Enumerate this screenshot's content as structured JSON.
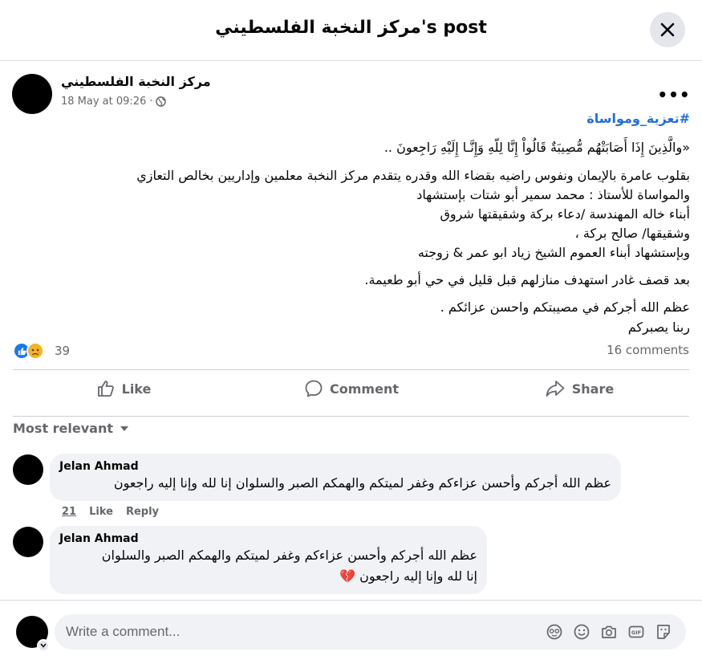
{
  "header": {
    "title": "مركز النخبة الفلسطيني's post"
  },
  "post": {
    "author": "مركز النخبة الفلسطيني",
    "timestamp": "18 May at 09:26",
    "separator": "·",
    "more": "•••",
    "hashtag": "#تعزية_ومواساة",
    "lines": [
      "«والَّذِينَ إِذَا أَصَابَتْهُم مُّصِيبَةٌ قَالُواْ إِنَّا لِلّهِ وَإِنَّـا إِلَيْهِ رَاجِعونَ ..",
      "بقلوب عامرة بالإيمان ونفوس راضيه بقضاء الله وقدره  يتقدم مركز النخبة معلمين وإداريين بخالص التعازي",
      "والمواساة للأستاذ : محمد سمير أبو شتات بإستشهاد",
      "أبناء خاله المهندسة /دعاء بركة وشقيقتها شروق",
      "وشقيقها/ صالح بركة ،",
      "وبإستشهاد أبناء العموم الشيخ زياد ابو عمر & زوجته",
      "بعد قصف غادر استهدف منازلهم قبل قليل في حي أبو طعيمة.",
      "عظم الله أجركم في مصيبتكم واحسن عزائكم .",
      "ربنا يصبركم"
    ],
    "reaction_count": "39",
    "comments_count": "16 comments"
  },
  "actions": {
    "like": "Like",
    "comment": "Comment",
    "share": "Share"
  },
  "sort_label": "Most relevant",
  "comments": [
    {
      "name": "Jelan Ahmad",
      "lines": [
        "عظم الله أجركم وأحسن عزاءكم وغفر لميتكم والهمكم الصبر والسلوان إنا لله وإنا إليه راجعون"
      ],
      "time": "21",
      "like": "Like",
      "reply": "Reply"
    },
    {
      "name": "Jelan Ahmad",
      "lines": [
        "عظم الله أجركم وأحسن عزاءكم وغفر لميتكم والهمكم الصبر والسلوان",
        "إنا لله وإنا إليه راجعون 💔"
      ]
    }
  ],
  "composer": {
    "placeholder": "Write a comment..."
  },
  "icons": {
    "close": "close-icon",
    "globe": "globe-icon",
    "like": "thumbs-up-icon",
    "comment": "speech-bubble-icon",
    "share": "share-arrow-icon",
    "avatar_sticker": "avatar-sticker-icon",
    "emoji": "emoji-icon",
    "camera": "camera-icon",
    "gif": "gif-icon",
    "sticker": "sticker-icon"
  },
  "colors": {
    "accent": "#1877f2",
    "hashtag": "#216fdb",
    "secondary_text": "#65676b",
    "bubble": "#f0f2f5"
  }
}
